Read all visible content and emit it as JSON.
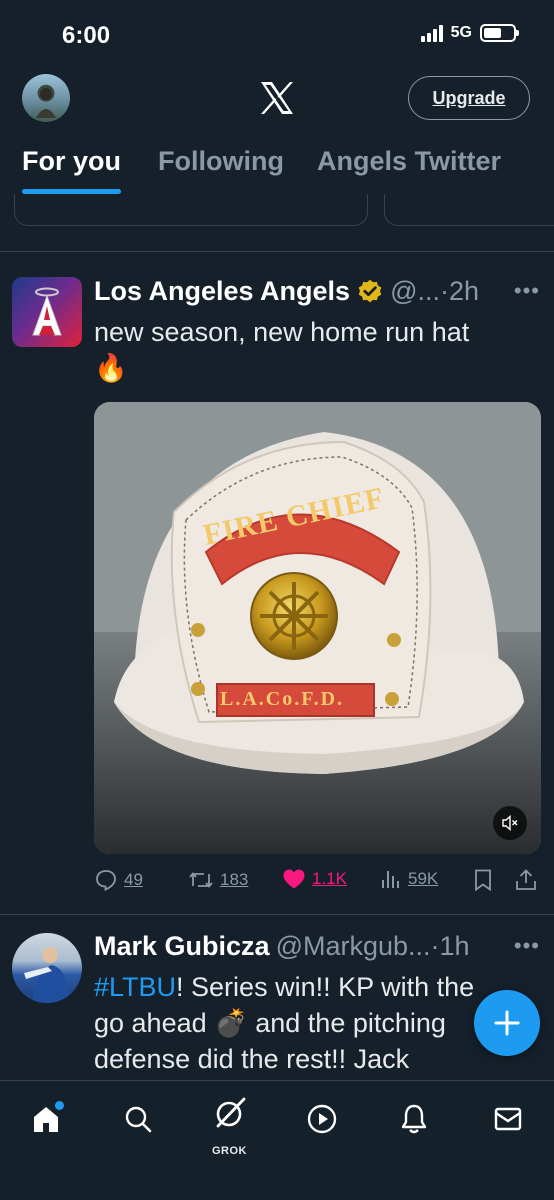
{
  "status_bar": {
    "time": "6:00",
    "network": "5G"
  },
  "header": {
    "upgrade_label": "Upgrade"
  },
  "tabs": [
    {
      "label": "For you",
      "active": true
    },
    {
      "label": "Following",
      "active": false
    },
    {
      "label": "Angels Twitter",
      "active": false
    }
  ],
  "tweets": [
    {
      "name": "Los Angeles Angels",
      "handle": "@...",
      "time": "·2h",
      "verified": "gold-check-icon",
      "text": "new season, new home run hat",
      "emoji": "🔥",
      "media": {
        "helmet_top_text": "FIRE CHIEF",
        "helmet_bottom_text": "L.A.Co.F.D."
      },
      "actions": {
        "replies": "49",
        "reposts": "183",
        "likes": "1.1K",
        "views": "59K"
      }
    },
    {
      "name": "Mark Gubicza",
      "handle": "@Markgub...",
      "time": "·1h",
      "hashtag": "#LTBU",
      "text_1": "! Series win!! KP with the",
      "text_2a": "go ahead ",
      "emoji_bomb": "💣",
      "text_2b": " and the pitching",
      "text_3": "defense did the rest!! Jack"
    }
  ],
  "bottom_nav": {
    "grok_label": "GROK"
  },
  "colors": {
    "background": "#15202b",
    "accent": "#1d9bf0",
    "like": "#f91880",
    "muted": "#8b98a5"
  }
}
